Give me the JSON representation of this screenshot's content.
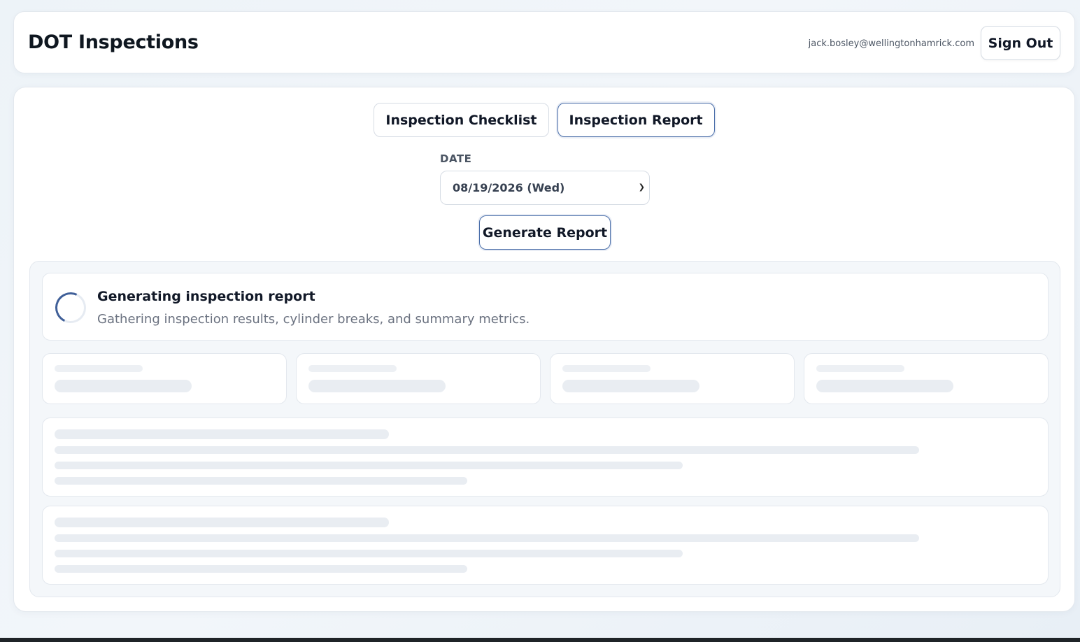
{
  "header": {
    "title": "DOT Inspections",
    "user_email": "jack.bosley@wellingtonhamrick.com",
    "signout_label": "Sign Out"
  },
  "tabs": [
    {
      "label": "Inspection Checklist",
      "active": false
    },
    {
      "label": "Inspection Report",
      "active": true
    }
  ],
  "date_filter": {
    "label": "DATE",
    "selected": "08/19/2026 (Wed)"
  },
  "generate_button": {
    "label": "Generate Report"
  },
  "loading": {
    "title": "Generating inspection report",
    "subtitle": "Gathering inspection results, cylinder breaks, and summary metrics."
  },
  "colors": {
    "accent": "#4a6ea9",
    "spinner": "#3f5f98",
    "skeleton": "#e9edf2"
  }
}
